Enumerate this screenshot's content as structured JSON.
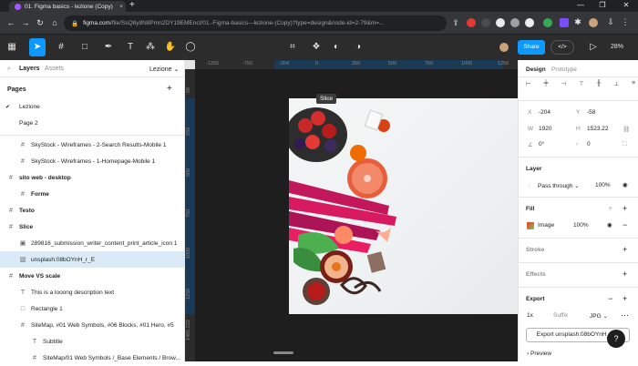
{
  "browser": {
    "tab_title": "01. Figma basics - lezione (Copy)",
    "tab_close": "×",
    "new_tab": "+",
    "url_host": "figma.com",
    "url_path": "/file/SsQ8y8N8Pmn2DY19EMEncI/01.-Figma-basics---lezione-(Copy)?type=design&node-id=2-79&m=..."
  },
  "toolbar": {
    "share_label": "Share",
    "dev_label": "</>",
    "zoom_label": "28%"
  },
  "left_panel": {
    "tab_layers": "Layers",
    "tab_assets": "Assets",
    "page_select": "Lezione",
    "pages_heading": "Pages",
    "add_page": "+",
    "pages": [
      {
        "label": "Lezione",
        "check": "✔"
      },
      {
        "label": "Page 2",
        "check": ""
      }
    ],
    "layers": [
      {
        "label": "SkyStock - Wireframes - 2-Search Results-Mobile 1",
        "kind": "frame",
        "bold": false,
        "indent": 1,
        "selected": false
      },
      {
        "label": "SkyStock - Wireframes - 1-Homepage-Mobile 1",
        "kind": "frame",
        "bold": false,
        "indent": 1,
        "selected": false
      },
      {
        "label": "sito web - desktop",
        "kind": "frame",
        "bold": true,
        "indent": 0,
        "selected": false
      },
      {
        "label": "Forme",
        "kind": "frame",
        "bold": true,
        "indent": 1,
        "selected": false
      },
      {
        "label": "Testo",
        "kind": "frame",
        "bold": true,
        "indent": 0,
        "selected": false
      },
      {
        "label": "Slice",
        "kind": "frame",
        "bold": true,
        "indent": 0,
        "selected": false
      },
      {
        "label": "289816_submission_writer_content_print_article_icon 1",
        "kind": "group",
        "bold": false,
        "indent": 1,
        "selected": false
      },
      {
        "label": "unsplash:08bOYnH_r_E",
        "kind": "image",
        "bold": false,
        "indent": 1,
        "selected": true
      },
      {
        "label": "Move VS scale",
        "kind": "frame",
        "bold": true,
        "indent": 0,
        "selected": false
      },
      {
        "label": "This is a looong description text",
        "kind": "text",
        "bold": false,
        "indent": 1,
        "selected": false
      },
      {
        "label": "Rectangle 1",
        "kind": "rect",
        "bold": false,
        "indent": 1,
        "selected": false
      },
      {
        "label": "SiteMap, #01 Web Symbols, #06 Blocks, #01 Hero, #5",
        "kind": "frame",
        "bold": false,
        "indent": 1,
        "selected": false
      },
      {
        "label": "Subtitle",
        "kind": "text",
        "bold": false,
        "indent": 2,
        "selected": false
      },
      {
        "label": "SiteMap/01 Web Symbols /_Base Elements / Brow...",
        "kind": "frame",
        "bold": false,
        "indent": 2,
        "selected": false
      }
    ]
  },
  "canvas": {
    "slice_label": "Slice",
    "ruler_h": [
      "-1250",
      "-750",
      "-204",
      "0",
      "250",
      "500",
      "750",
      "1000",
      "1250"
    ],
    "ruler_v": [
      "-58",
      "250",
      "500",
      "750",
      "1000",
      "1250",
      "1465.222"
    ]
  },
  "right_panel": {
    "tab_design": "Design",
    "tab_prototype": "Prototype",
    "x_label": "X",
    "x_value": "-204",
    "y_label": "Y",
    "y_value": "-58",
    "w_label": "W",
    "w_value": "1920",
    "h_label": "H",
    "h_value": "1523.22",
    "rotation": "0°",
    "radius": "0",
    "layer_heading": "Layer",
    "blend_mode": "Pass through",
    "layer_opacity": "100%",
    "fill_heading": "Fill",
    "fill_type": "Image",
    "fill_opacity": "100%",
    "stroke_heading": "Stroke",
    "effects_heading": "Effects",
    "export_heading": "Export",
    "export_scale": "1x",
    "export_suffix": "Suffix",
    "export_format": "JPG",
    "export_button": "Export unsplash:08bOYnH_r_E",
    "preview_label": "Preview",
    "help": "?"
  },
  "colors": {
    "accent": "#0d99ff",
    "selection_bg": "#daebf7",
    "toolbar_bg": "#2c2c2c",
    "chrome_bg": "#35363a"
  }
}
